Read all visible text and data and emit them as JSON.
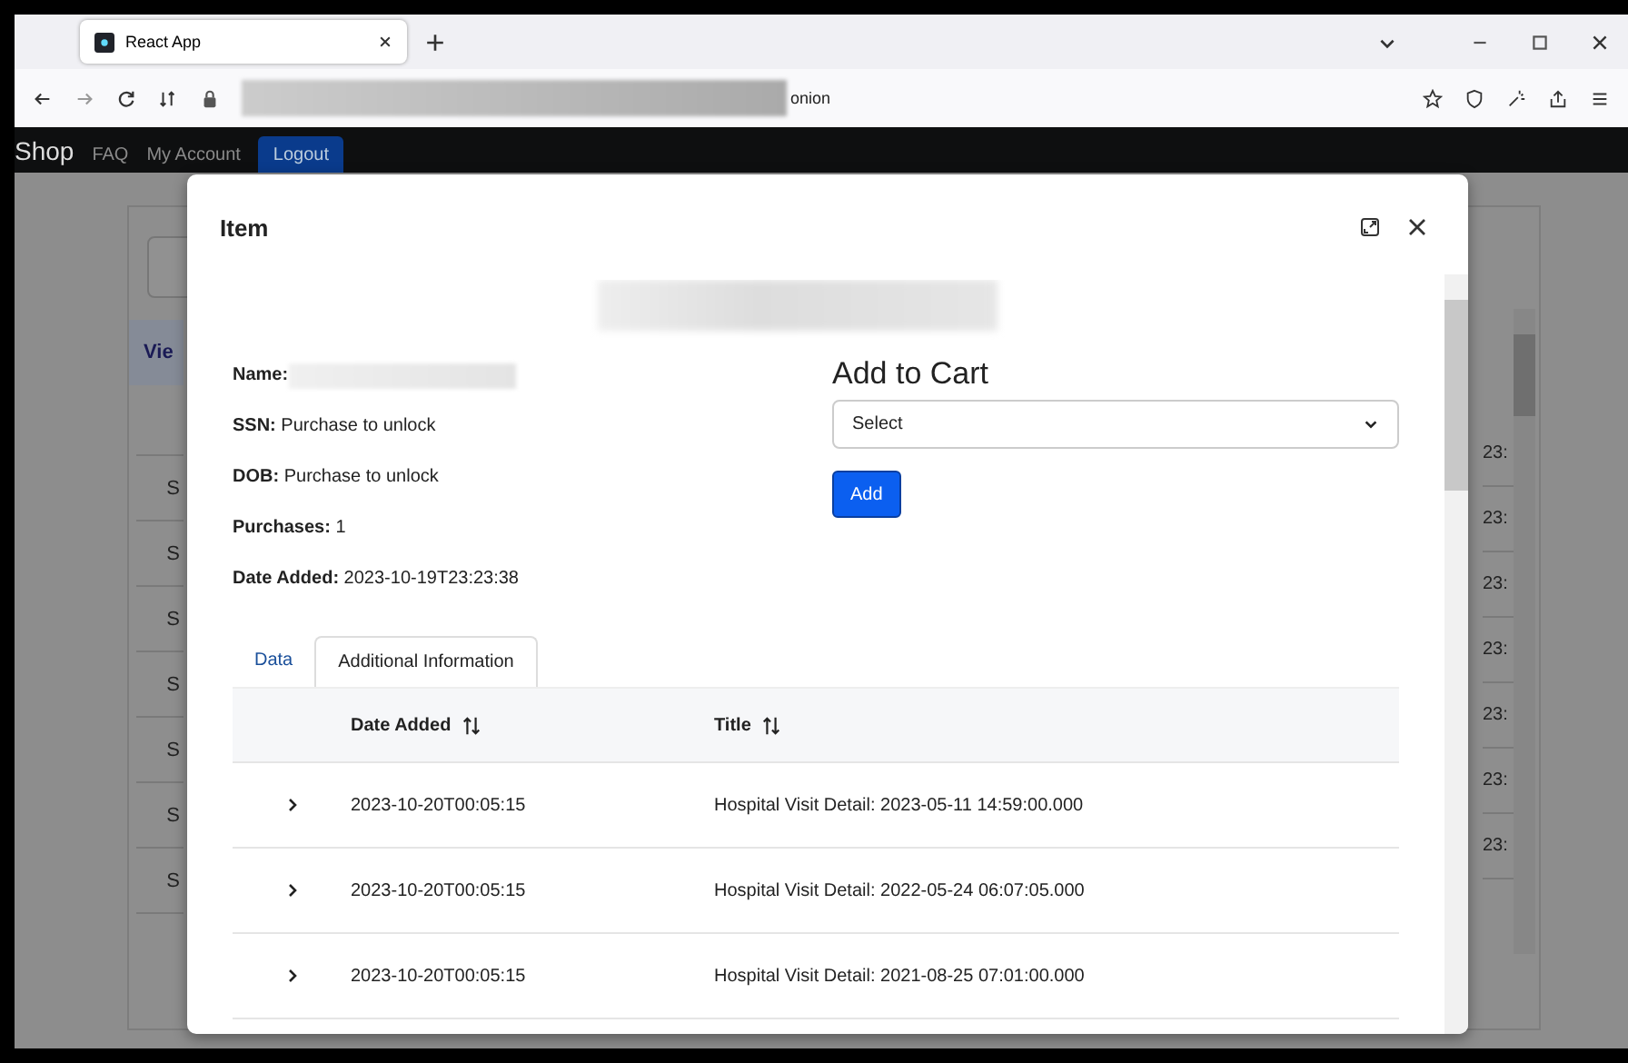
{
  "browser": {
    "tab_title": "React App",
    "url_tail": "onion",
    "url_redacted": true
  },
  "navbar": {
    "brand": "Shop",
    "links": [
      "FAQ",
      "My Account"
    ],
    "logout": "Logout"
  },
  "background_table": {
    "header_fragment": "Vie",
    "left_fragments": [
      "S",
      "S",
      "S",
      "S",
      "S",
      "S",
      "S"
    ],
    "right_fragments": [
      "23:",
      "23:",
      "23:",
      "23:",
      "23:",
      "23:",
      "23:"
    ]
  },
  "modal": {
    "title": "Item",
    "image_redacted": true,
    "fields": [
      {
        "label": "Name:",
        "redacted": true
      },
      {
        "label": "SSN:",
        "value": "Purchase to unlock",
        "redacted": false
      },
      {
        "label": "DOB:",
        "value": "Purchase to unlock",
        "redacted": false
      },
      {
        "label": "Purchases:",
        "value": "1",
        "redacted": false
      },
      {
        "label": "Date Added:",
        "value": "2023-10-19T23:23:38",
        "redacted": false
      }
    ],
    "cart": {
      "heading": "Add to Cart",
      "select_value": "Select",
      "button": "Add"
    },
    "tabs": [
      {
        "label": "Data",
        "selected": false
      },
      {
        "label": "Additional Information",
        "selected": true
      }
    ],
    "table": {
      "columns": [
        "Date Added",
        "Title"
      ],
      "rows": [
        {
          "expanded": false,
          "date_added": "2023-10-20T00:05:15",
          "title": "Hospital Visit Detail: 2023-05-11 14:59:00.000"
        },
        {
          "expanded": false,
          "date_added": "2023-10-20T00:05:15",
          "title": "Hospital Visit Detail: 2022-05-24 06:07:05.000"
        },
        {
          "expanded": false,
          "date_added": "2023-10-20T00:05:15",
          "title": "Hospital Visit Detail: 2021-08-25 07:01:00.000"
        }
      ]
    }
  }
}
